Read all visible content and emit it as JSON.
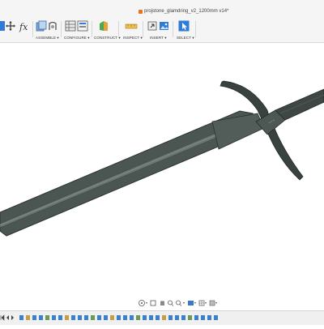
{
  "title_bar": {
    "document_title": "projstone_glamdring_v2_1200mm v14*"
  },
  "toolbar": {
    "groups": [
      {
        "label": "ASSEMBLE ▾"
      },
      {
        "label": "CONFIGURE ▾"
      },
      {
        "label": "CONSTRUCT ▾"
      },
      {
        "label": "INSPECT ▾"
      },
      {
        "label": "INSERT ▾"
      },
      {
        "label": "SELECT ▾"
      }
    ],
    "formula_symbol": "fx"
  },
  "viewport": {
    "model": "sword",
    "colors": {
      "blade": "#4b5552",
      "blade_edge": "#2c3331",
      "highlight": "#6a7571",
      "hilt": "#3a4240",
      "background": "#ffffff"
    }
  }
}
